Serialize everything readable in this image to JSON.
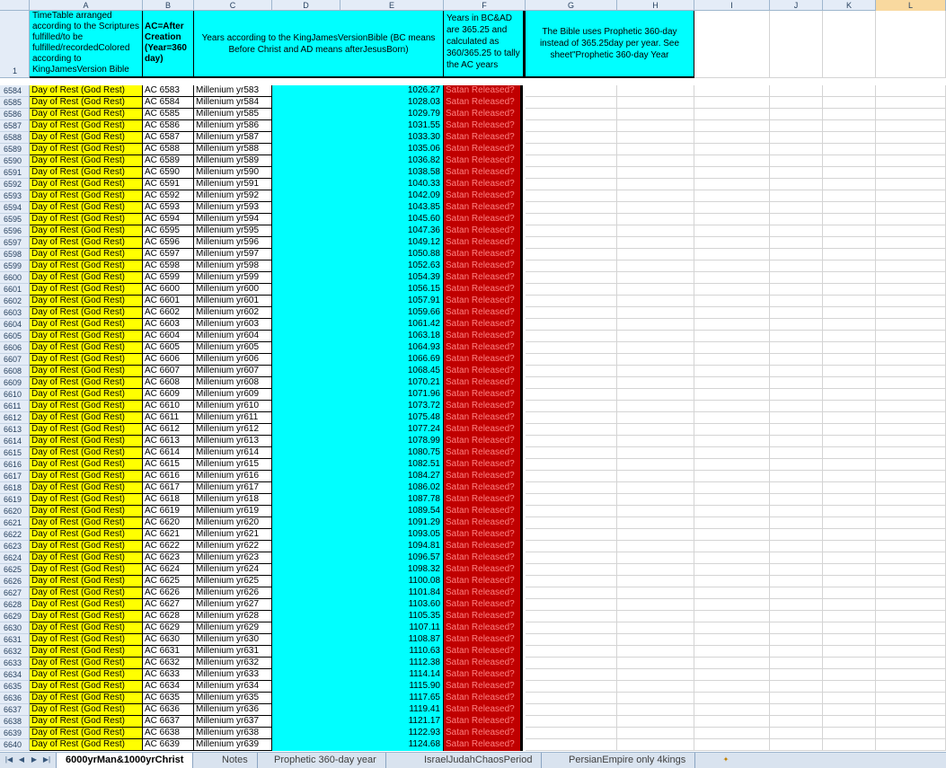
{
  "columns": [
    "A",
    "B",
    "C",
    "D",
    "E",
    "F",
    "G",
    "H",
    "I",
    "J",
    "K",
    "L"
  ],
  "header_row": {
    "row_number": "1",
    "a": "TimeTable arranged according to the Scriptures fulfilled/to be fulfilled/recordedColored according to KingJamesVersion Bible",
    "b": "AC=After Creation (Year=360 day)",
    "cde": "Years according to the KingJamesVersionBible (BC means Before Christ and AD means afterJesusBorn)",
    "f": "Years in BC&AD are 365.25 and calculated as 360/365.25 to tally the AC years",
    "gh": "The Bible uses Prophetic 360-day instead of 365.25day per year. See sheet\"Prophetic 360-day Year"
  },
  "rows": [
    [
      "6584",
      "Day of Rest (God Rest)",
      "AC 6583",
      "Millenium yr583",
      "1026.27",
      "Satan Released?"
    ],
    [
      "6585",
      "Day of Rest (God Rest)",
      "AC 6584",
      "Millenium yr584",
      "1028.03",
      "Satan Released?"
    ],
    [
      "6586",
      "Day of Rest (God Rest)",
      "AC 6585",
      "Millenium yr585",
      "1029.79",
      "Satan Released?"
    ],
    [
      "6587",
      "Day of Rest (God Rest)",
      "AC 6586",
      "Millenium yr586",
      "1031.55",
      "Satan Released?"
    ],
    [
      "6588",
      "Day of Rest (God Rest)",
      "AC 6587",
      "Millenium yr587",
      "1033.30",
      "Satan Released?"
    ],
    [
      "6589",
      "Day of Rest (God Rest)",
      "AC 6588",
      "Millenium yr588",
      "1035.06",
      "Satan Released?"
    ],
    [
      "6590",
      "Day of Rest (God Rest)",
      "AC 6589",
      "Millenium yr589",
      "1036.82",
      "Satan Released?"
    ],
    [
      "6591",
      "Day of Rest (God Rest)",
      "AC 6590",
      "Millenium yr590",
      "1038.58",
      "Satan Released?"
    ],
    [
      "6592",
      "Day of Rest (God Rest)",
      "AC 6591",
      "Millenium yr591",
      "1040.33",
      "Satan Released?"
    ],
    [
      "6593",
      "Day of Rest (God Rest)",
      "AC 6592",
      "Millenium yr592",
      "1042.09",
      "Satan Released?"
    ],
    [
      "6594",
      "Day of Rest (God Rest)",
      "AC 6593",
      "Millenium yr593",
      "1043.85",
      "Satan Released?"
    ],
    [
      "6595",
      "Day of Rest (God Rest)",
      "AC 6594",
      "Millenium yr594",
      "1045.60",
      "Satan Released?"
    ],
    [
      "6596",
      "Day of Rest (God Rest)",
      "AC 6595",
      "Millenium yr595",
      "1047.36",
      "Satan Released?"
    ],
    [
      "6597",
      "Day of Rest (God Rest)",
      "AC 6596",
      "Millenium yr596",
      "1049.12",
      "Satan Released?"
    ],
    [
      "6598",
      "Day of Rest (God Rest)",
      "AC 6597",
      "Millenium yr597",
      "1050.88",
      "Satan Released?"
    ],
    [
      "6599",
      "Day of Rest (God Rest)",
      "AC 6598",
      "Millenium yr598",
      "1052.63",
      "Satan Released?"
    ],
    [
      "6600",
      "Day of Rest (God Rest)",
      "AC 6599",
      "Millenium yr599",
      "1054.39",
      "Satan Released?"
    ],
    [
      "6601",
      "Day of Rest (God Rest)",
      "AC 6600",
      "Millenium yr600",
      "1056.15",
      "Satan Released?"
    ],
    [
      "6602",
      "Day of Rest (God Rest)",
      "AC 6601",
      "Millenium yr601",
      "1057.91",
      "Satan Released?"
    ],
    [
      "6603",
      "Day of Rest (God Rest)",
      "AC 6602",
      "Millenium yr602",
      "1059.66",
      "Satan Released?"
    ],
    [
      "6604",
      "Day of Rest (God Rest)",
      "AC 6603",
      "Millenium yr603",
      "1061.42",
      "Satan Released?"
    ],
    [
      "6605",
      "Day of Rest (God Rest)",
      "AC 6604",
      "Millenium yr604",
      "1063.18",
      "Satan Released?"
    ],
    [
      "6606",
      "Day of Rest (God Rest)",
      "AC 6605",
      "Millenium yr605",
      "1064.93",
      "Satan Released?"
    ],
    [
      "6607",
      "Day of Rest (God Rest)",
      "AC 6606",
      "Millenium yr606",
      "1066.69",
      "Satan Released?"
    ],
    [
      "6608",
      "Day of Rest (God Rest)",
      "AC 6607",
      "Millenium yr607",
      "1068.45",
      "Satan Released?"
    ],
    [
      "6609",
      "Day of Rest (God Rest)",
      "AC 6608",
      "Millenium yr608",
      "1070.21",
      "Satan Released?"
    ],
    [
      "6610",
      "Day of Rest (God Rest)",
      "AC 6609",
      "Millenium yr609",
      "1071.96",
      "Satan Released?"
    ],
    [
      "6611",
      "Day of Rest (God Rest)",
      "AC 6610",
      "Millenium yr610",
      "1073.72",
      "Satan Released?"
    ],
    [
      "6612",
      "Day of Rest (God Rest)",
      "AC 6611",
      "Millenium yr611",
      "1075.48",
      "Satan Released?"
    ],
    [
      "6613",
      "Day of Rest (God Rest)",
      "AC 6612",
      "Millenium yr612",
      "1077.24",
      "Satan Released?"
    ],
    [
      "6614",
      "Day of Rest (God Rest)",
      "AC 6613",
      "Millenium yr613",
      "1078.99",
      "Satan Released?"
    ],
    [
      "6615",
      "Day of Rest (God Rest)",
      "AC 6614",
      "Millenium yr614",
      "1080.75",
      "Satan Released?"
    ],
    [
      "6616",
      "Day of Rest (God Rest)",
      "AC 6615",
      "Millenium yr615",
      "1082.51",
      "Satan Released?"
    ],
    [
      "6617",
      "Day of Rest (God Rest)",
      "AC 6616",
      "Millenium yr616",
      "1084.27",
      "Satan Released?"
    ],
    [
      "6618",
      "Day of Rest (God Rest)",
      "AC 6617",
      "Millenium yr617",
      "1086.02",
      "Satan Released?"
    ],
    [
      "6619",
      "Day of Rest (God Rest)",
      "AC 6618",
      "Millenium yr618",
      "1087.78",
      "Satan Released?"
    ],
    [
      "6620",
      "Day of Rest (God Rest)",
      "AC 6619",
      "Millenium yr619",
      "1089.54",
      "Satan Released?"
    ],
    [
      "6621",
      "Day of Rest (God Rest)",
      "AC 6620",
      "Millenium yr620",
      "1091.29",
      "Satan Released?"
    ],
    [
      "6622",
      "Day of Rest (God Rest)",
      "AC 6621",
      "Millenium yr621",
      "1093.05",
      "Satan Released?"
    ],
    [
      "6623",
      "Day of Rest (God Rest)",
      "AC 6622",
      "Millenium yr622",
      "1094.81",
      "Satan Released?"
    ],
    [
      "6624",
      "Day of Rest (God Rest)",
      "AC 6623",
      "Millenium yr623",
      "1096.57",
      "Satan Released?"
    ],
    [
      "6625",
      "Day of Rest (God Rest)",
      "AC 6624",
      "Millenium yr624",
      "1098.32",
      "Satan Released?"
    ],
    [
      "6626",
      "Day of Rest (God Rest)",
      "AC 6625",
      "Millenium yr625",
      "1100.08",
      "Satan Released?"
    ],
    [
      "6627",
      "Day of Rest (God Rest)",
      "AC 6626",
      "Millenium yr626",
      "1101.84",
      "Satan Released?"
    ],
    [
      "6628",
      "Day of Rest (God Rest)",
      "AC 6627",
      "Millenium yr627",
      "1103.60",
      "Satan Released?"
    ],
    [
      "6629",
      "Day of Rest (God Rest)",
      "AC 6628",
      "Millenium yr628",
      "1105.35",
      "Satan Released?"
    ],
    [
      "6630",
      "Day of Rest (God Rest)",
      "AC 6629",
      "Millenium yr629",
      "1107.11",
      "Satan Released?"
    ],
    [
      "6631",
      "Day of Rest (God Rest)",
      "AC 6630",
      "Millenium yr630",
      "1108.87",
      "Satan Released?"
    ],
    [
      "6632",
      "Day of Rest (God Rest)",
      "AC 6631",
      "Millenium yr631",
      "1110.63",
      "Satan Released?"
    ],
    [
      "6633",
      "Day of Rest (God Rest)",
      "AC 6632",
      "Millenium yr632",
      "1112.38",
      "Satan Released?"
    ],
    [
      "6634",
      "Day of Rest (God Rest)",
      "AC 6633",
      "Millenium yr633",
      "1114.14",
      "Satan Released?"
    ],
    [
      "6635",
      "Day of Rest (God Rest)",
      "AC 6634",
      "Millenium yr634",
      "1115.90",
      "Satan Released?"
    ],
    [
      "6636",
      "Day of Rest (God Rest)",
      "AC 6635",
      "Millenium yr635",
      "1117.65",
      "Satan Released?"
    ],
    [
      "6637",
      "Day of Rest (God Rest)",
      "AC 6636",
      "Millenium yr636",
      "1119.41",
      "Satan Released?"
    ],
    [
      "6638",
      "Day of Rest (God Rest)",
      "AC 6637",
      "Millenium yr637",
      "1121.17",
      "Satan Released?"
    ],
    [
      "6639",
      "Day of Rest (God Rest)",
      "AC 6638",
      "Millenium yr638",
      "1122.93",
      "Satan Released?"
    ],
    [
      "6640",
      "Day of Rest (God Rest)",
      "AC 6639",
      "Millenium yr639",
      "1124.68",
      "Satan Released?"
    ]
  ],
  "sheet_tabs": [
    {
      "label": "6000yrMan&1000yrChrist",
      "active": true
    },
    {
      "label": "Notes",
      "active": false
    },
    {
      "label": "Prophetic 360-day year",
      "active": false
    },
    {
      "label": "IsraelJudahChaosPeriod",
      "active": false
    },
    {
      "label": "PersianEmpire only 4kings",
      "active": false
    }
  ],
  "tab_nav": {
    "first": "first-sheet-icon",
    "prev": "prev-sheet-icon",
    "next": "next-sheet-icon",
    "last": "last-sheet-icon",
    "insert": "insert-sheet-icon"
  },
  "colors": {
    "yellow": "#ffff00",
    "cyan": "#00ffff",
    "red": "#c00000",
    "selected_col": "#f9d99f"
  }
}
